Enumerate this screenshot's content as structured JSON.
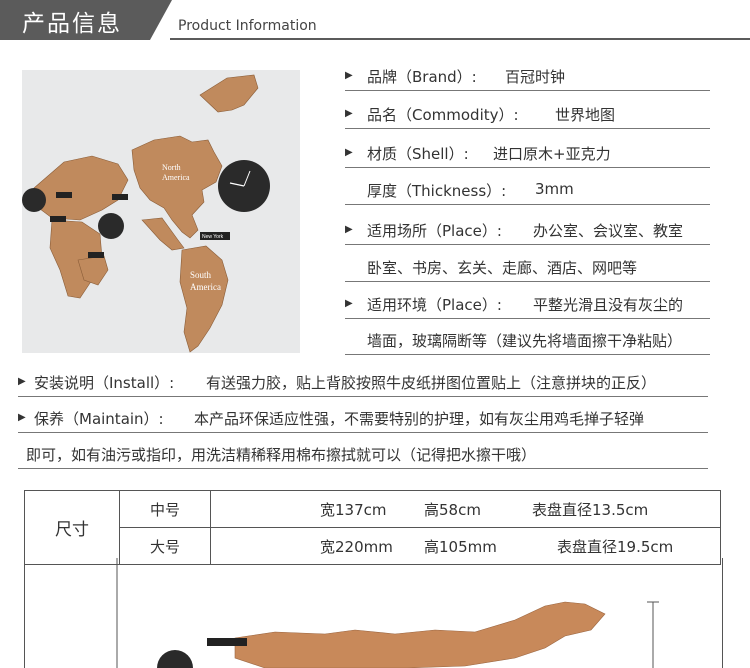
{
  "header": {
    "title": "产品信息",
    "subtitle": "Product Information"
  },
  "photo": {
    "labels": {
      "north_america_1": "North",
      "north_america_2": "America",
      "south_america_1": "South",
      "south_america_2": "America",
      "tag_new_york": "New York"
    }
  },
  "specs": [
    {
      "key": "品牌（Brand）:",
      "value": "百冠时钟"
    },
    {
      "key": "品名（Commodity）:",
      "value": "世界地图"
    },
    {
      "key": "材质（Shell）:",
      "value": "进口原木+亚克力"
    },
    {
      "key": "厚度（Thickness）:",
      "value": "3mm"
    },
    {
      "key": "适用场所（Place）:",
      "value": "办公室、会议室、教室"
    },
    {
      "key": "",
      "value": "卧室、书房、玄关、走廊、酒店、网吧等"
    },
    {
      "key": "适用环境（Place）:",
      "value": "平整光滑且没有灰尘的"
    },
    {
      "key": "",
      "value": "墙面，玻璃隔断等（建议先将墙面擦干净粘贴）"
    }
  ],
  "install": {
    "key": "安装说明（Install）:",
    "value": "有送强力胶，贴上背胶按照牛皮纸拼图位置贴上（注意拼块的正反）"
  },
  "maintain": {
    "key": "保养（Maintain）:",
    "value": "本产品环保适应性强，不需要特别的护理，如有灰尘用鸡毛掸子轻弹",
    "value2": "即可，如有油污或指印，用洗洁精稀释用棉布擦拭就可以（记得把水擦干哦）"
  },
  "size_table": {
    "label": "尺寸",
    "rows": [
      {
        "name": "中号",
        "width": "宽137cm",
        "height": "高58cm",
        "dial": "表盘直径13.5cm"
      },
      {
        "name": "大号",
        "width": "宽220mm",
        "height": "高105mm",
        "dial": "表盘直径19.5cm"
      }
    ]
  },
  "colors": {
    "header": "#5b5b5b",
    "wood": "#c08a5d",
    "clock": "#2a2a2a"
  }
}
